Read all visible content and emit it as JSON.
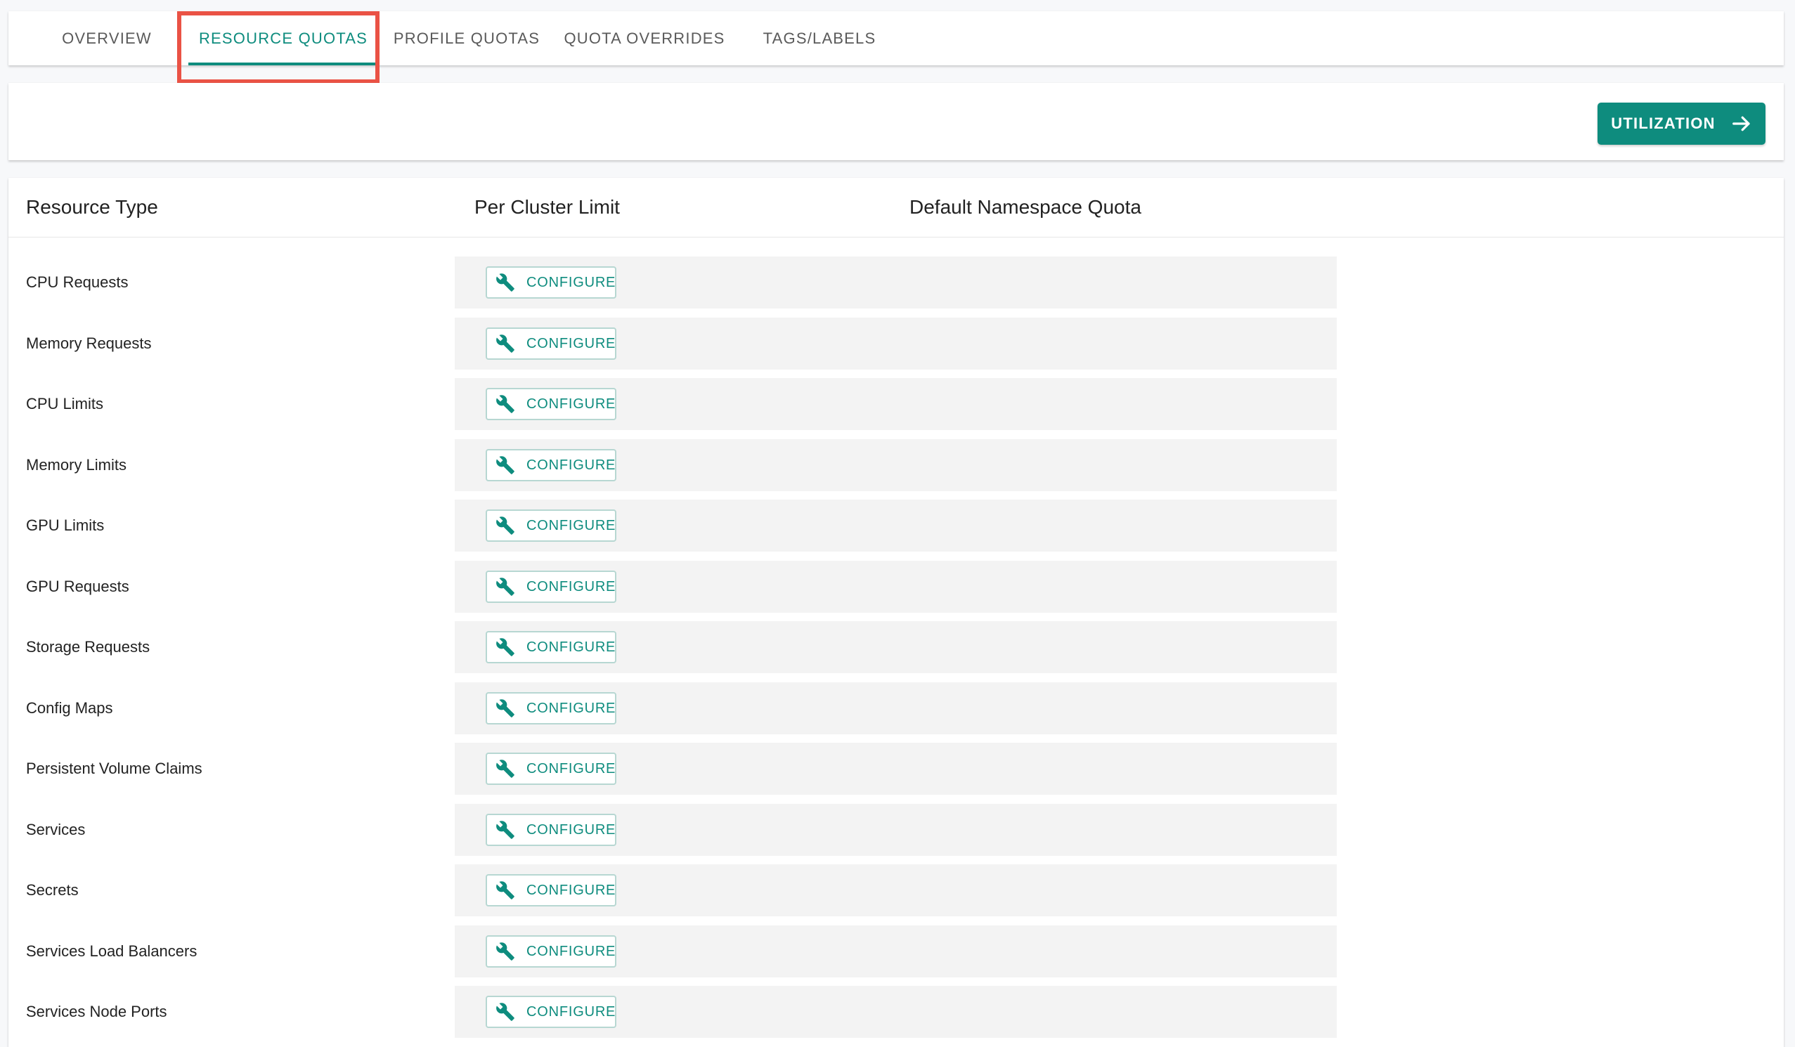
{
  "tabs": [
    {
      "label": "OVERVIEW"
    },
    {
      "label": "RESOURCE QUOTAS",
      "active": true
    },
    {
      "label": "PROFILE QUOTAS"
    },
    {
      "label": "QUOTA OVERRIDES"
    },
    {
      "label": "TAGS/LABELS"
    }
  ],
  "actions": {
    "utilization_label": "UTILIZATION",
    "utilization_icon": "arrow-right-icon"
  },
  "table": {
    "headers": {
      "resource_type": "Resource Type",
      "per_cluster_limit": "Per Cluster Limit",
      "default_namespace_quota": "Default Namespace Quota"
    },
    "configure_label": "CONFIGURE",
    "configure_icon": "wrench-icon",
    "rows": [
      {
        "label": "CPU Requests"
      },
      {
        "label": "Memory Requests"
      },
      {
        "label": "CPU Limits"
      },
      {
        "label": "Memory Limits"
      },
      {
        "label": "GPU Limits"
      },
      {
        "label": "GPU Requests"
      },
      {
        "label": "Storage Requests"
      },
      {
        "label": "Config Maps"
      },
      {
        "label": "Persistent Volume Claims"
      },
      {
        "label": "Services"
      },
      {
        "label": "Secrets"
      },
      {
        "label": "Services Load Balancers"
      },
      {
        "label": "Services Node Ports"
      }
    ]
  },
  "colors": {
    "accent": "#0e8c7e",
    "highlight": "#ea5245",
    "row_background": "#f3f3f3"
  }
}
